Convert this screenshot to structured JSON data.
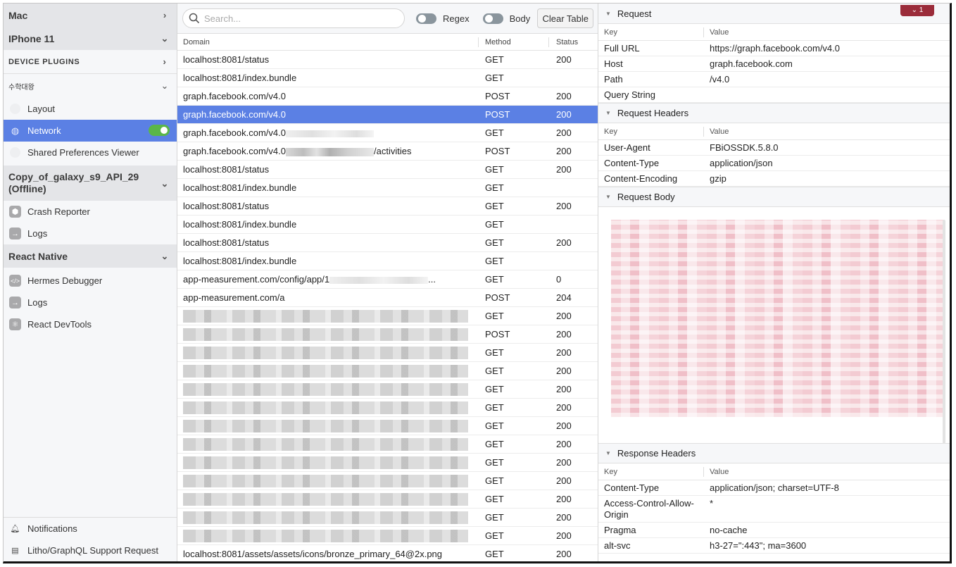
{
  "sidebar": {
    "devices": {
      "mac": "Mac",
      "iphone": "IPhone 11",
      "galaxy": "Copy_of_galaxy_s9_API_29 (Offline)",
      "react_native": "React Native"
    },
    "device_plugins_label": "DEVICE PLUGINS",
    "app_group": "수학대왕",
    "app_plugins": [
      {
        "label": "Layout",
        "icon": "layout-icon"
      },
      {
        "label": "Network",
        "icon": "globe-icon",
        "active": true,
        "enabled": true
      },
      {
        "label": "Shared Preferences Viewer",
        "icon": "preferences-icon"
      }
    ],
    "galaxy_plugins": [
      {
        "label": "Crash Reporter",
        "icon": "crash-reporter-icon"
      },
      {
        "label": "Logs",
        "icon": "logs-icon"
      }
    ],
    "rn_plugins": [
      {
        "label": "Hermes Debugger",
        "icon": "code-icon"
      },
      {
        "label": "Logs",
        "icon": "logs-icon"
      },
      {
        "label": "React DevTools",
        "icon": "react-icon"
      }
    ],
    "footer": [
      {
        "label": "Notifications",
        "icon": "bell-icon"
      },
      {
        "label": "Litho/GraphQL Support Request",
        "icon": "support-icon"
      }
    ]
  },
  "toolbar": {
    "search_placeholder": "Search...",
    "regex_label": "Regex",
    "body_label": "Body",
    "clear_label": "Clear Table"
  },
  "table": {
    "columns": [
      "Domain",
      "Method",
      "Status"
    ],
    "rows": [
      {
        "domain": "localhost:8081/status",
        "method": "GET",
        "status": "200"
      },
      {
        "domain": "localhost:8081/index.bundle",
        "method": "GET",
        "status": ""
      },
      {
        "domain": "graph.facebook.com/v4.0",
        "method": "POST",
        "status": "200"
      },
      {
        "domain": "graph.facebook.com/v4.0",
        "method": "POST",
        "status": "200",
        "selected": true
      },
      {
        "domain": "graph.facebook.com/v4.0",
        "redacted_suffix": "",
        "method": "GET",
        "status": "200"
      },
      {
        "domain": "graph.facebook.com/v4.0",
        "redacted_suffix": "/activities",
        "method": "POST",
        "status": "200"
      },
      {
        "domain": "localhost:8081/status",
        "method": "GET",
        "status": "200"
      },
      {
        "domain": "localhost:8081/index.bundle",
        "method": "GET",
        "status": ""
      },
      {
        "domain": "localhost:8081/status",
        "method": "GET",
        "status": "200"
      },
      {
        "domain": "localhost:8081/index.bundle",
        "method": "GET",
        "status": ""
      },
      {
        "domain": "localhost:8081/status",
        "method": "GET",
        "status": "200"
      },
      {
        "domain": "localhost:8081/index.bundle",
        "method": "GET",
        "status": ""
      },
      {
        "domain": "app-measurement.com/config/app/1",
        "redacted_suffix": "...",
        "method": "GET",
        "status": "0"
      },
      {
        "domain": "app-measurement.com/a",
        "method": "POST",
        "status": "204"
      },
      {
        "domain": "",
        "redacted": true,
        "method": "GET",
        "status": "200"
      },
      {
        "domain": "",
        "redacted": true,
        "method": "POST",
        "status": "200"
      },
      {
        "domain": "",
        "redacted": true,
        "method": "GET",
        "status": "200"
      },
      {
        "domain": "",
        "redacted": true,
        "method": "GET",
        "status": "200"
      },
      {
        "domain": "",
        "redacted": true,
        "method": "GET",
        "status": "200"
      },
      {
        "domain": "",
        "redacted": true,
        "method": "GET",
        "status": "200"
      },
      {
        "domain": "",
        "redacted": true,
        "method": "GET",
        "status": "200"
      },
      {
        "domain": "",
        "redacted": true,
        "method": "GET",
        "status": "200"
      },
      {
        "domain": "",
        "redacted": true,
        "method": "GET",
        "status": "200"
      },
      {
        "domain": "",
        "redacted": true,
        "method": "GET",
        "status": "200"
      },
      {
        "domain": "",
        "redacted": true,
        "method": "GET",
        "status": "200"
      },
      {
        "domain": "",
        "redacted": true,
        "method": "GET",
        "status": "200"
      },
      {
        "domain": "",
        "redacted": true,
        "method": "GET",
        "status": "200"
      },
      {
        "domain": "localhost:8081/assets/assets/icons/bronze_primary_64@2x.png",
        "method": "GET",
        "status": "200"
      }
    ]
  },
  "details": {
    "badge": "⌄ 1",
    "key_header": "Key",
    "value_header": "Value",
    "request": {
      "title": "Request",
      "rows": [
        {
          "key": "Full URL",
          "value": "https://graph.facebook.com/v4.0"
        },
        {
          "key": "Host",
          "value": "graph.facebook.com"
        },
        {
          "key": "Path",
          "value": "/v4.0"
        },
        {
          "key": "Query String",
          "value": ""
        }
      ]
    },
    "request_headers": {
      "title": "Request Headers",
      "rows": [
        {
          "key": "User-Agent",
          "value": "FBiOSSDK.5.8.0"
        },
        {
          "key": "Content-Type",
          "value": "application/json"
        },
        {
          "key": "Content-Encoding",
          "value": "gzip"
        }
      ]
    },
    "request_body": {
      "title": "Request Body"
    },
    "response_headers": {
      "title": "Response Headers",
      "rows": [
        {
          "key": "Content-Type",
          "value": "application/json; charset=UTF-8"
        },
        {
          "key": "Access-Control-Allow-Origin",
          "value": "*"
        },
        {
          "key": "Pragma",
          "value": "no-cache"
        },
        {
          "key": "alt-svc",
          "value": "h3-27=\":443\"; ma=3600"
        }
      ]
    }
  },
  "colors": {
    "accent": "#5b80e4",
    "toggle_on": "#5ab64a",
    "badge": "#9b2c3a"
  }
}
